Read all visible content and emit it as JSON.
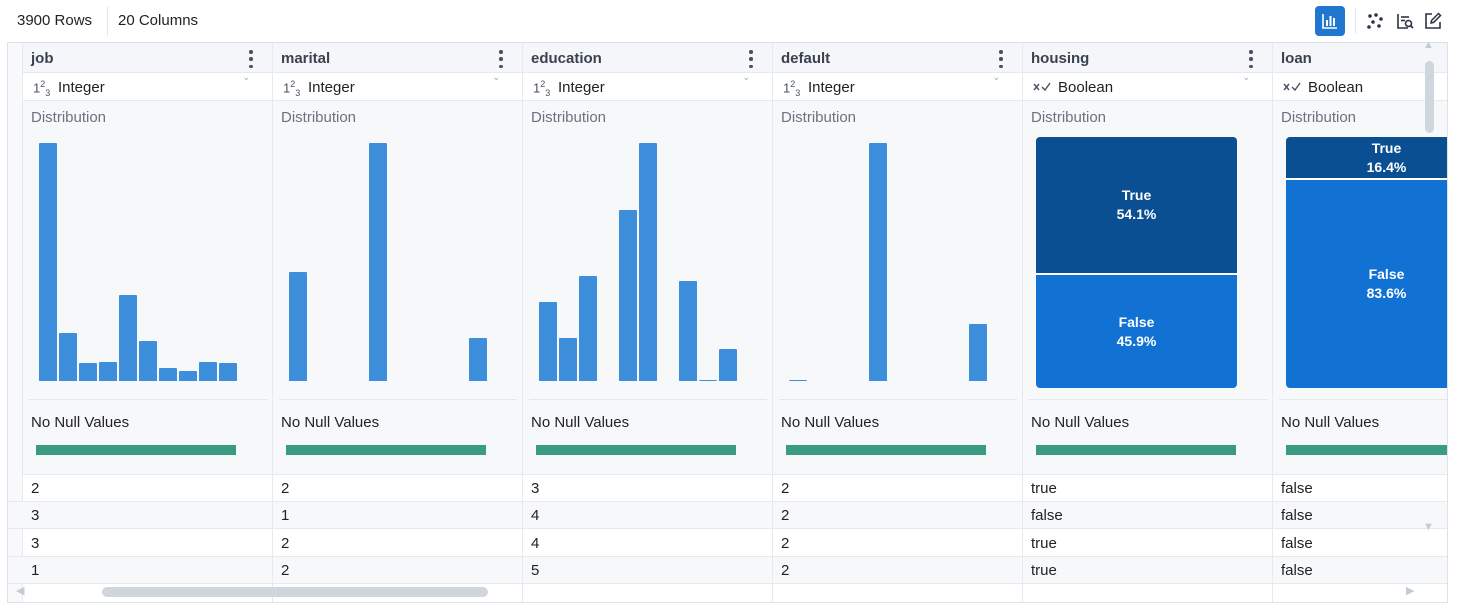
{
  "toolbar": {
    "rows_label": "3900 Rows",
    "columns_label": "20 Columns",
    "buttons": [
      {
        "name": "distribution-view-icon",
        "active": true
      },
      {
        "name": "scatter-icon",
        "active": false
      },
      {
        "name": "search-list-icon",
        "active": false
      },
      {
        "name": "edit-icon",
        "active": false
      }
    ]
  },
  "summary": {
    "distribution_label": "Distribution",
    "null_label": "No Null Values"
  },
  "colors": {
    "bar": "#3d8fdc",
    "true_segment": "#0b4f93",
    "false_segment": "#1272d4",
    "null_bar": "#3a9b83",
    "active_button": "#1f77d0"
  },
  "columns": [
    {
      "name": "job",
      "type": "Integer",
      "type_icon": "integer-type-icon",
      "distribution": [
        1.0,
        0.2,
        0.076,
        0.08,
        0.36,
        0.17,
        0.055,
        0.04,
        0.08,
        0.075
      ],
      "rows": [
        "2",
        "3",
        "3",
        "1"
      ]
    },
    {
      "name": "marital",
      "type": "Integer",
      "type_icon": "integer-type-icon",
      "distribution": [
        0.46,
        0,
        0,
        0,
        1.0,
        0,
        0,
        0,
        0,
        0.18
      ],
      "rows": [
        "2",
        "1",
        "2",
        "2"
      ]
    },
    {
      "name": "education",
      "type": "Integer",
      "type_icon": "integer-type-icon",
      "distribution": [
        0.33,
        0.18,
        0.44,
        0,
        0.72,
        1.0,
        0,
        0.42,
        0.004,
        0.135
      ],
      "rows": [
        "3",
        "4",
        "4",
        "5"
      ]
    },
    {
      "name": "default",
      "type": "Integer",
      "type_icon": "integer-type-icon",
      "distribution": [
        0.005,
        0,
        0,
        0,
        1.0,
        0,
        0,
        0,
        0,
        0.24
      ],
      "rows": [
        "2",
        "2",
        "2",
        "2"
      ]
    },
    {
      "name": "housing",
      "type": "Boolean",
      "type_icon": "boolean-type-icon",
      "true_label": "True",
      "true_pct": "54.1%",
      "true_value": 54.1,
      "false_label": "False",
      "false_pct": "45.9%",
      "false_value": 45.9,
      "rows": [
        "true",
        "false",
        "true",
        "true"
      ]
    },
    {
      "name": "loan",
      "type": "Boolean",
      "type_icon": "boolean-type-icon",
      "true_label": "True",
      "true_pct": "16.4%",
      "true_value": 16.4,
      "false_label": "False",
      "false_pct": "83.6%",
      "false_value": 83.6,
      "rows": [
        "false",
        "false",
        "false",
        "false"
      ]
    }
  ]
}
